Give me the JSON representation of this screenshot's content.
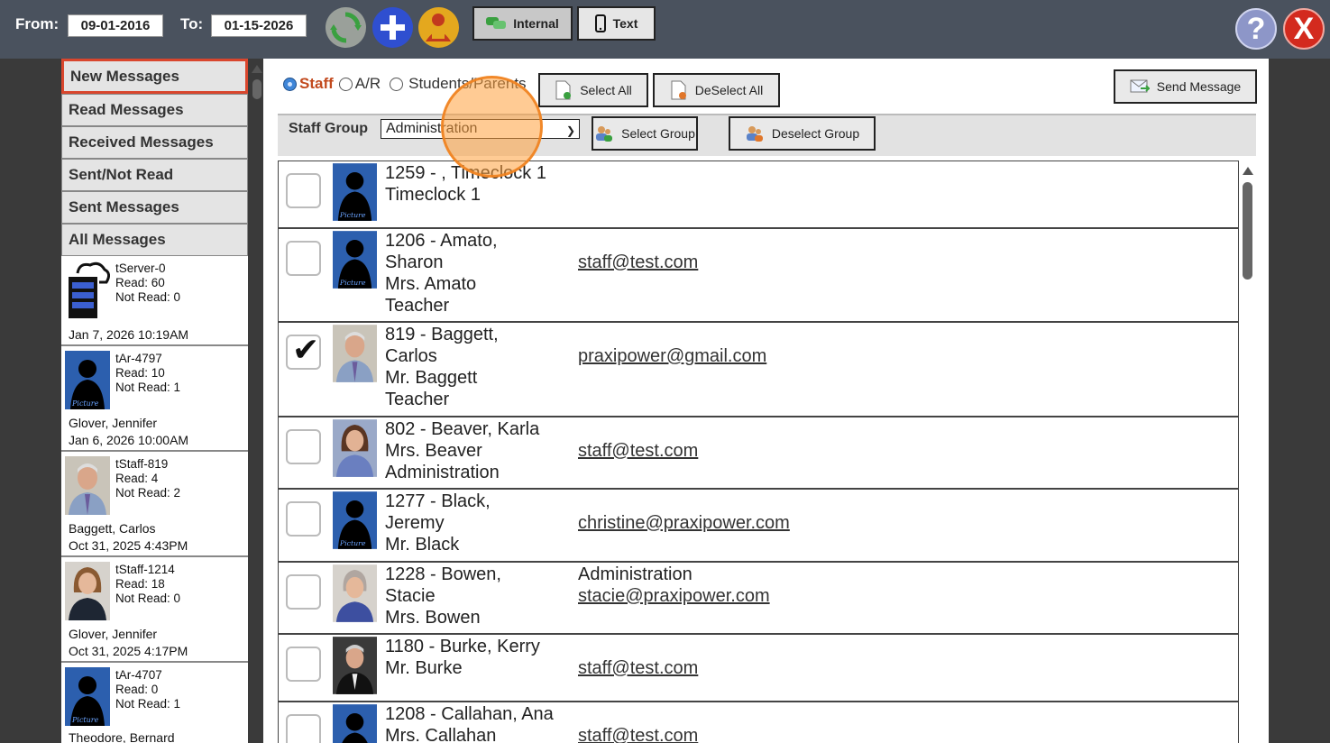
{
  "header": {
    "from_label": "From:",
    "from_date": "09-01-2016",
    "to_label": "To:",
    "to_date": "01-15-2026",
    "internal_label": "Internal",
    "text_label": "Text",
    "help_label": "?",
    "close_label": "X"
  },
  "sidebar": {
    "nav": [
      "New Messages",
      "Read Messages",
      "Received Messages",
      "Sent/Not Read",
      "Sent Messages",
      "All Messages"
    ],
    "conversations": [
      {
        "id": "tServer-0",
        "read": "Read: 60",
        "not_read": "Not Read: 0",
        "name": "",
        "date": "Jan 7, 2026 10:19AM",
        "avatar": "server-icon"
      },
      {
        "id": "tAr-4797",
        "read": "Read: 10",
        "not_read": "Not Read: 1",
        "name": "Glover, Jennifer",
        "date": "Jan 6, 2026 10:00AM",
        "avatar": "silhouette"
      },
      {
        "id": "tStaff-819",
        "read": "Read: 4",
        "not_read": "Not Read: 2",
        "name": "Baggett, Carlos",
        "date": "Oct 31, 2025 4:43PM",
        "avatar": "man-photo"
      },
      {
        "id": "tStaff-1214",
        "read": "Read: 18",
        "not_read": "Not Read: 0",
        "name": "Glover, Jennifer",
        "date": "Oct 31, 2025 4:17PM",
        "avatar": "woman-photo"
      },
      {
        "id": "tAr-4707",
        "read": "Read: 0",
        "not_read": "Not Read: 1",
        "name": "Theodore, Bernard",
        "date": "",
        "avatar": "silhouette"
      }
    ],
    "picture_label": "Picture"
  },
  "main": {
    "radio_staff": "Staff",
    "radio_ar": "A/R",
    "radio_students": "Students/Parents",
    "select_all": "Select All",
    "deselect_all": "DeSelect All",
    "send_message": "Send Message",
    "staff_group_label": "Staff Group",
    "staff_group_value": "Administration",
    "select_group": "Select Group",
    "deselect_group": "Deselect Group",
    "rows": [
      {
        "line1": "1259 - , Timeclock 1",
        "line2": "Timeclock 1",
        "line3": "",
        "line4": "",
        "extra": "",
        "email": "",
        "checked": false,
        "photo": "silhouette"
      },
      {
        "line1": "1206 - Amato,",
        "line2": "Sharon",
        "line3": "Mrs. Amato",
        "line4": "Teacher",
        "extra": "",
        "email": "staff@test.com",
        "checked": false,
        "photo": "silhouette"
      },
      {
        "line1": "819 - Baggett,",
        "line2": "Carlos",
        "line3": "Mr. Baggett",
        "line4": "Teacher",
        "extra": "",
        "email": "praxipower@gmail.com",
        "checked": true,
        "photo": "man-photo"
      },
      {
        "line1": "802 - Beaver, Karla",
        "line2": "Mrs. Beaver",
        "line3": "Administration",
        "line4": "",
        "extra": "",
        "email": "staff@test.com",
        "checked": false,
        "photo": "woman-photo"
      },
      {
        "line1": "1277 - Black,",
        "line2": "Jeremy",
        "line3": "Mr. Black",
        "line4": "",
        "extra": "",
        "email": "christine@praxipower.com",
        "checked": false,
        "photo": "silhouette"
      },
      {
        "line1": "1228 - Bowen,",
        "line2": "Stacie",
        "line3": "Mrs. Bowen",
        "line4": "",
        "extra": "Administration",
        "email": "stacie@praxipower.com",
        "checked": false,
        "photo": "woman-photo2"
      },
      {
        "line1": "1180 - Burke, Kerry",
        "line2": "Mr. Burke",
        "line3": "",
        "line4": "",
        "extra": "",
        "email": "staff@test.com",
        "checked": false,
        "photo": "man-photo2"
      },
      {
        "line1": "1208 - Callahan, Ana",
        "line2": "Mrs. Callahan",
        "line3": "",
        "line4": "",
        "extra": "",
        "email": "staff@test.com",
        "checked": false,
        "photo": "silhouette"
      }
    ]
  },
  "colors": {
    "topbar": "#4a525e",
    "accent_ring": "#f08a2a",
    "selected_nav_border": "#d9462d"
  }
}
